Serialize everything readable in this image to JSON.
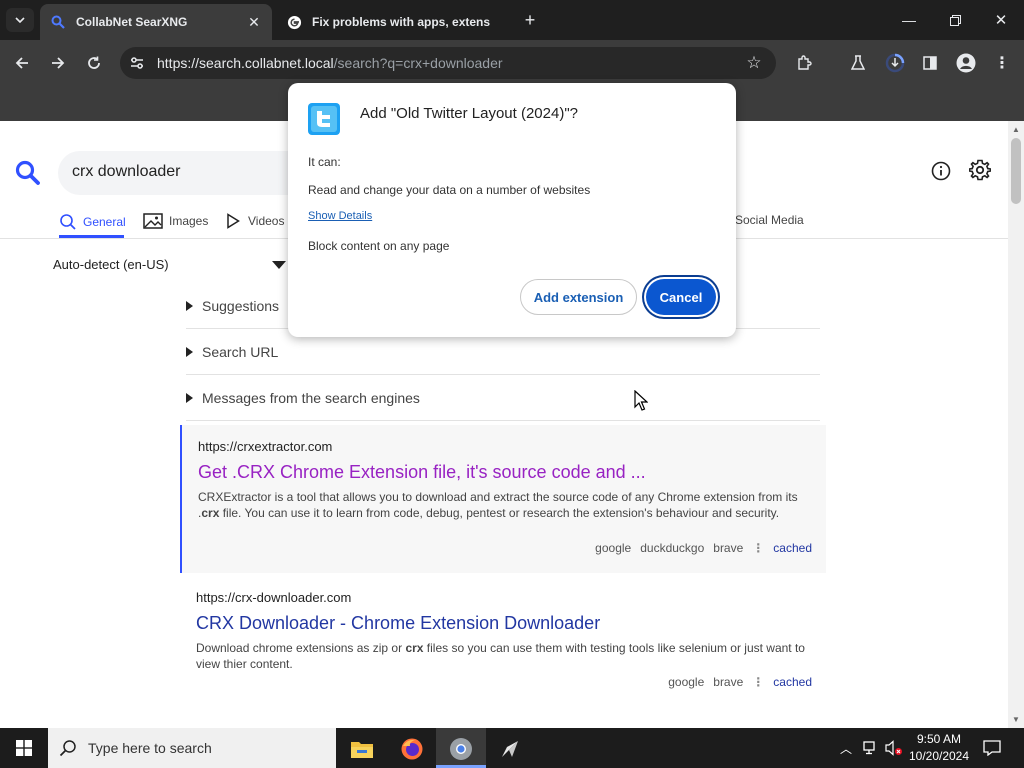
{
  "browser": {
    "tabs": [
      {
        "title": "CollabNet SearXNG",
        "active": true
      },
      {
        "title": "Fix problems with apps, extens",
        "active": false
      }
    ],
    "url_host": "https://search.collabnet.local",
    "url_path": "/search?q=crx+downloader"
  },
  "search": {
    "query": "crx downloader",
    "categories": [
      "General",
      "Images",
      "Videos",
      "Social Media"
    ],
    "language": "Auto-detect (en-US)",
    "sections": [
      "Suggestions",
      "Search URL",
      "Messages from the search engines"
    ]
  },
  "results": [
    {
      "url": "https://crxextractor.com",
      "title": "Get .CRX Chrome Extension file, it's source code and ...",
      "desc_before": "CRXExtractor is a tool that allows you to download and extract the source code of any Chrome extension from its .",
      "desc_bold": "crx",
      "desc_after": " file. You can use it to learn from code, debug, pentest or research the extension's behaviour and security.",
      "engines": [
        "google",
        "duckduckgo",
        "brave"
      ],
      "cached": "cached"
    },
    {
      "url": "https://crx-downloader.com",
      "title": "CRX Downloader - Chrome Extension Downloader",
      "desc_before": "Download chrome extensions as zip or ",
      "desc_bold": "crx",
      "desc_after": " files so you can use them with testing tools like selenium or just want to view thier content.",
      "engines": [
        "google",
        "brave"
      ],
      "cached": "cached"
    }
  ],
  "dialog": {
    "title": "Add \"Old Twitter Layout (2024)\"?",
    "it_can": "It can:",
    "perm1": "Read and change your data on a number of websites",
    "show_details": "Show Details",
    "perm2": "Block content on any page",
    "add_label": "Add extension",
    "cancel_label": "Cancel"
  },
  "taskbar": {
    "search_placeholder": "Type here to search",
    "time": "9:50 AM",
    "date": "10/20/2024"
  },
  "colors": {
    "accent": "#3050ff",
    "visited": "#9822c3",
    "link": "#2237a2",
    "dialog_primary": "#0b57d0"
  }
}
